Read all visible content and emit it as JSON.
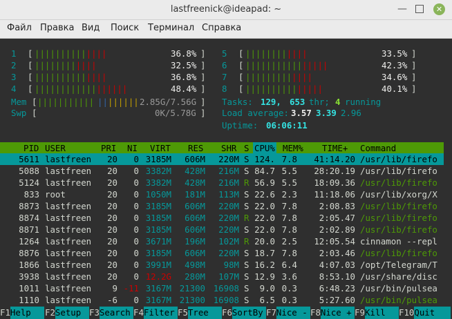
{
  "window": {
    "title": "lastfreenick@ideapad: ~",
    "menu": [
      "Файл",
      "Правка",
      "Вид",
      "Поиск",
      "Терминал",
      "Справка"
    ]
  },
  "cpus": [
    {
      "id": "1",
      "percent": "36.8%",
      "bar": "||||||||||||||"
    },
    {
      "id": "2",
      "percent": "32.5%",
      "bar": "||||||||||||"
    },
    {
      "id": "3",
      "percent": "36.8%",
      "bar": "||||||||||||||"
    },
    {
      "id": "4",
      "percent": "48.4%",
      "bar": "||||||||||||||||||"
    },
    {
      "id": "5",
      "percent": "33.5%",
      "bar": "||||||||||||"
    },
    {
      "id": "6",
      "percent": "42.3%",
      "bar": "||||||||||||||||"
    },
    {
      "id": "7",
      "percent": "34.6%",
      "bar": "|||||||||||||"
    },
    {
      "id": "8",
      "percent": "40.1%",
      "bar": "|||||||||||||||"
    }
  ],
  "mem": {
    "label": "Mem",
    "value": "2.85G/7.56G"
  },
  "swp": {
    "label": "Swp",
    "value": "0K/5.78G"
  },
  "tasks": {
    "label": "Tasks:",
    "count": "129,",
    "thr": "653",
    "thr_label": "thr;",
    "running": "4",
    "running_label": "running"
  },
  "load": {
    "label": "Load average:",
    "v1": "3.57",
    "v2": "3.39",
    "v3": "2.96"
  },
  "uptime": {
    "label": "Uptime:",
    "value": "06:06:11"
  },
  "columns": [
    "PID",
    "USER",
    "PRI",
    "NI",
    "VIRT",
    "RES",
    "SHR",
    "S",
    "CPU%",
    "MEM%",
    "TIME+",
    "Command"
  ],
  "processes": [
    {
      "pid": "5611",
      "user": "lastfreen",
      "pri": "20",
      "ni": "0",
      "virt": "3185M",
      "res": "606M",
      "shr": "220M",
      "s": "S",
      "cpu": "124.",
      "mem": "7.8",
      "time": "41:14.20",
      "cmd": "/usr/lib/firefo"
    },
    {
      "pid": "5088",
      "user": "lastfreen",
      "pri": "20",
      "ni": "0",
      "virt": "3382M",
      "res": "428M",
      "shr": "216M",
      "s": "S",
      "cpu": "84.7",
      "mem": "5.5",
      "time": "28:20.19",
      "cmd": "/usr/lib/firefo"
    },
    {
      "pid": "5124",
      "user": "lastfreen",
      "pri": "20",
      "ni": "0",
      "virt": "3382M",
      "res": "428M",
      "shr": "216M",
      "s": "R",
      "cpu": "56.9",
      "mem": "5.5",
      "time": "18:09.36",
      "cmd": "/usr/lib/firefo"
    },
    {
      "pid": "833",
      "user": "root",
      "pri": "20",
      "ni": "0",
      "virt": "1050M",
      "res": "181M",
      "shr": "113M",
      "s": "S",
      "cpu": "22.6",
      "mem": "2.3",
      "time": "11:18.06",
      "cmd": "/usr/lib/xorg/X"
    },
    {
      "pid": "8873",
      "user": "lastfreen",
      "pri": "20",
      "ni": "0",
      "virt": "3185M",
      "res": "606M",
      "shr": "220M",
      "s": "S",
      "cpu": "22.0",
      "mem": "7.8",
      "time": "2:08.83",
      "cmd": "/usr/lib/firefo"
    },
    {
      "pid": "8874",
      "user": "lastfreen",
      "pri": "20",
      "ni": "0",
      "virt": "3185M",
      "res": "606M",
      "shr": "220M",
      "s": "R",
      "cpu": "22.0",
      "mem": "7.8",
      "time": "2:05.47",
      "cmd": "/usr/lib/firefo"
    },
    {
      "pid": "8871",
      "user": "lastfreen",
      "pri": "20",
      "ni": "0",
      "virt": "3185M",
      "res": "606M",
      "shr": "220M",
      "s": "S",
      "cpu": "22.0",
      "mem": "7.8",
      "time": "2:02.89",
      "cmd": "/usr/lib/firefo"
    },
    {
      "pid": "1264",
      "user": "lastfreen",
      "pri": "20",
      "ni": "0",
      "virt": "3671M",
      "res": "196M",
      "shr": "102M",
      "s": "R",
      "cpu": "20.0",
      "mem": "2.5",
      "time": "12:05.54",
      "cmd": "cinnamon --repl"
    },
    {
      "pid": "8876",
      "user": "lastfreen",
      "pri": "20",
      "ni": "0",
      "virt": "3185M",
      "res": "606M",
      "shr": "220M",
      "s": "S",
      "cpu": "18.7",
      "mem": "7.8",
      "time": "2:03.46",
      "cmd": "/usr/lib/firefo"
    },
    {
      "pid": "1866",
      "user": "lastfreen",
      "pri": "20",
      "ni": "0",
      "virt": "3991M",
      "res": "498M",
      "shr": "98M",
      "s": "S",
      "cpu": "16.2",
      "mem": "6.4",
      "time": "4:07.03",
      "cmd": "/opt/Telegram/T"
    },
    {
      "pid": "3938",
      "user": "lastfreen",
      "pri": "20",
      "ni": "0",
      "virt": "12.2G",
      "res": "280M",
      "shr": "107M",
      "s": "S",
      "cpu": "12.9",
      "mem": "3.6",
      "time": "8:53.10",
      "cmd": "/usr/share/disc"
    },
    {
      "pid": "1011",
      "user": "lastfreen",
      "pri": "9",
      "ni": "-11",
      "virt": "3167M",
      "res": "21300",
      "shr": "16908",
      "s": "S",
      "cpu": "9.0",
      "mem": "0.3",
      "time": "6:48.23",
      "cmd": "/usr/bin/pulsea"
    },
    {
      "pid": "1110",
      "user": "lastfreen",
      "pri": "-6",
      "ni": "0",
      "virt": "3167M",
      "res": "21300",
      "shr": "16908",
      "s": "S",
      "cpu": "6.5",
      "mem": "0.3",
      "time": "5:27.60",
      "cmd": "/usr/bin/pulsea"
    }
  ],
  "footer": [
    {
      "key": "F1",
      "label": "Help"
    },
    {
      "key": "F2",
      "label": "Setup"
    },
    {
      "key": "F3",
      "label": "Search"
    },
    {
      "key": "F4",
      "label": "Filter"
    },
    {
      "key": "F5",
      "label": "Tree"
    },
    {
      "key": "F6",
      "label": "SortBy"
    },
    {
      "key": "F7",
      "label": "Nice -"
    },
    {
      "key": "F8",
      "label": "Nice +"
    },
    {
      "key": "F9",
      "label": "Kill"
    },
    {
      "key": "F10",
      "label": "Quit"
    }
  ],
  "colors": {
    "accent": "#06989a",
    "header": "#4e9a06",
    "terminal_bg": "#2f2f2f"
  }
}
